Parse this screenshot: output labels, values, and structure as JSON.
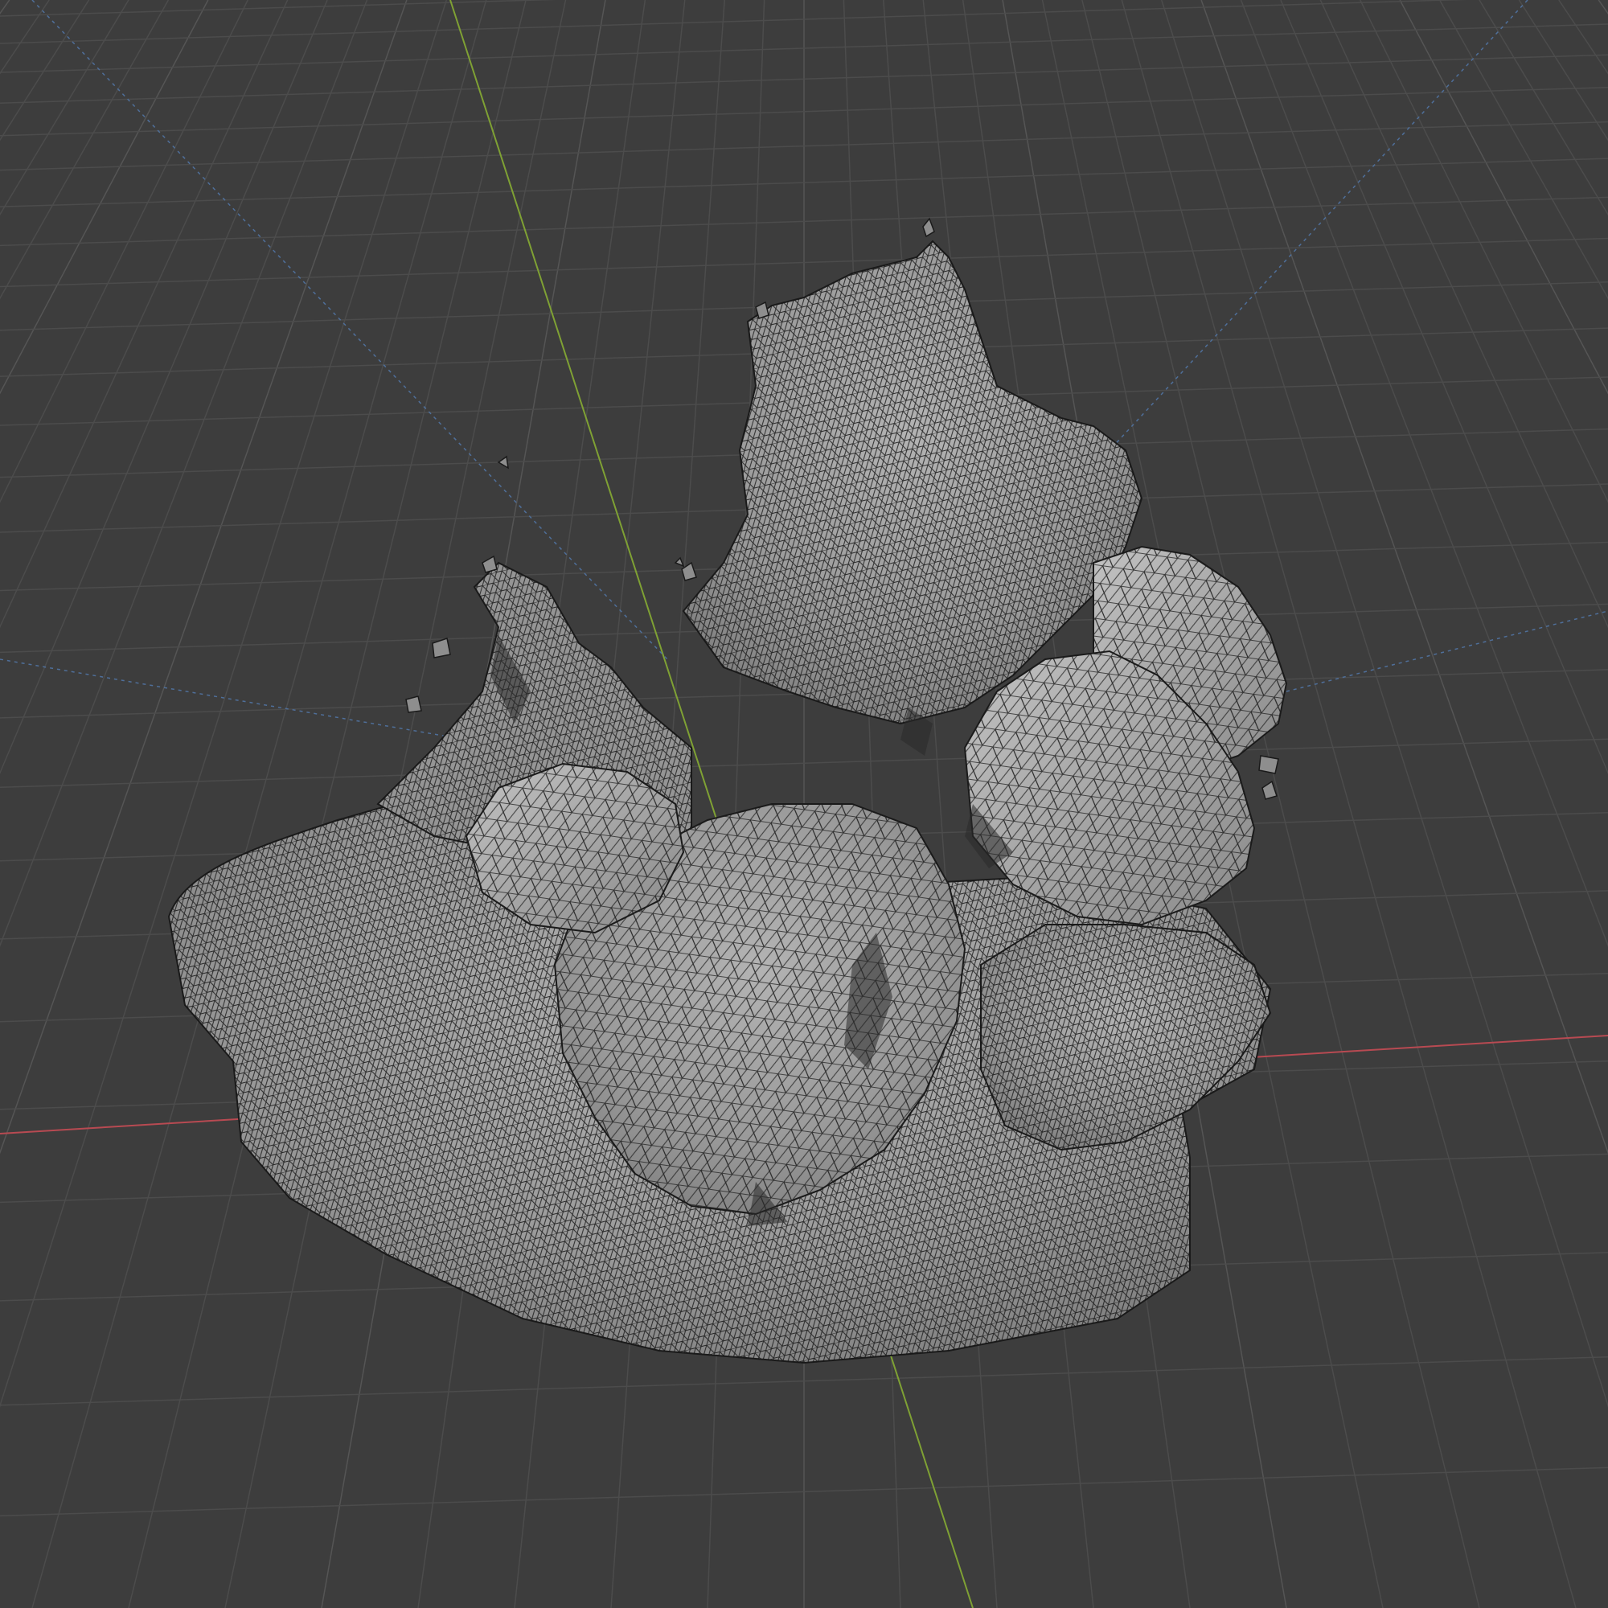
{
  "viewport": {
    "mode": "3d-viewport",
    "shading": "solid-wireframe-overlay",
    "background_color": "#3d3d3d",
    "grid_color": "#4c4c4c",
    "grid_strong_color": "#555555",
    "x_axis_color": "#b84a52",
    "y_axis_color": "#7fa134",
    "z_axis_dashed_color": "#4f6f9a",
    "mesh_fill_color": "#9a9a9a",
    "mesh_shadow_color": "#6e6e6e",
    "mesh_highlight_color": "#c4c4c4",
    "wire_color": "#1e1e1e"
  },
  "scene_object": {
    "type": "scanned-mesh",
    "icon": "rock-mesh-icon"
  }
}
